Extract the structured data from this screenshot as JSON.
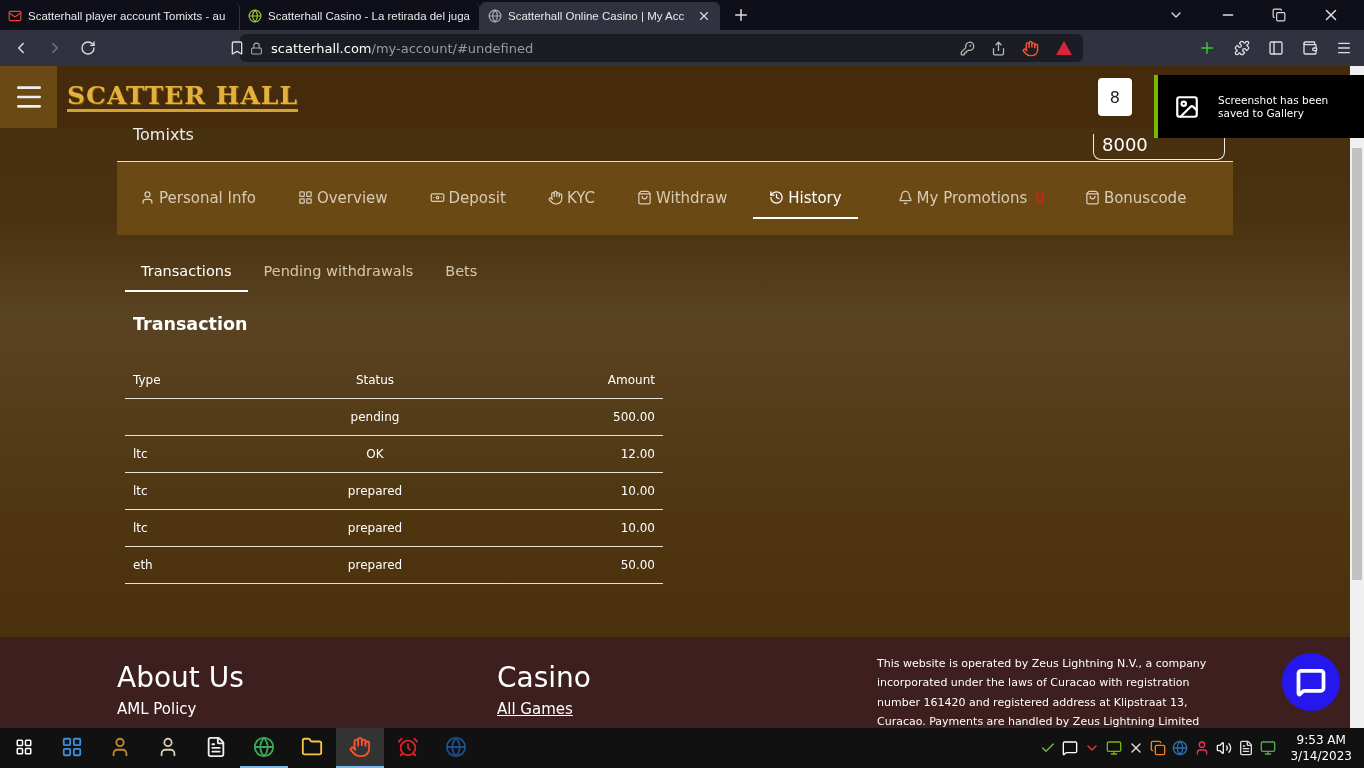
{
  "browser": {
    "tabs": [
      {
        "title": "Scatterhall player account Tomixts - au",
        "kind": "mail",
        "selected": false
      },
      {
        "title": "Scatterhall Casino - La retirada del juga",
        "kind": "letter",
        "selected": false
      },
      {
        "title": "Scatterhall Online Casino | My Acc",
        "kind": "globe",
        "selected": true
      }
    ],
    "url_host": "scatterhall.com",
    "url_path": "/my-account/#undefined"
  },
  "header": {
    "logo": "SCATTER HALL",
    "button_text": "8"
  },
  "notification": {
    "message": "Screenshot has been saved to Gallery"
  },
  "account": {
    "username": "Tomixts",
    "balance": "8000"
  },
  "nav": [
    {
      "label": "Personal Info",
      "kind": "user",
      "selected": false
    },
    {
      "label": "Overview",
      "kind": "grid",
      "selected": false
    },
    {
      "label": "Deposit",
      "kind": "deposit",
      "selected": false
    },
    {
      "label": "KYC",
      "kind": "hand",
      "selected": false
    },
    {
      "label": "Withdraw",
      "kind": "bag",
      "selected": false
    },
    {
      "label": "History",
      "kind": "history",
      "selected": true
    },
    {
      "label": "My Promotions",
      "kind": "bell",
      "selected": false,
      "badge": "0"
    },
    {
      "label": "Bonuscode",
      "kind": "bag",
      "selected": false
    }
  ],
  "subtabs": [
    {
      "label": "Transactions",
      "selected": true
    },
    {
      "label": "Pending withdrawals",
      "selected": false
    },
    {
      "label": "Bets",
      "selected": false
    }
  ],
  "table": {
    "title": "Transaction",
    "columns": [
      "Type",
      "Status",
      "Amount"
    ],
    "rows": [
      [
        "",
        "pending",
        "500.00"
      ],
      [
        "ltc",
        "OK",
        "12.00"
      ],
      [
        "ltc",
        "prepared",
        "10.00"
      ],
      [
        "ltc",
        "prepared",
        "10.00"
      ],
      [
        "eth",
        "prepared",
        "50.00"
      ]
    ]
  },
  "footer": {
    "columns": [
      {
        "heading": "About Us",
        "link": "AML Policy",
        "underlined": false
      },
      {
        "heading": "Casino",
        "link": "All Games",
        "underlined": true
      }
    ],
    "legal": "This website is operated by Zeus Lightning N.V., a company incorporated under the laws of Curacao with registration number 161420 and registered address at Klipstraat 13, Curacao. Payments are handled by Zeus Lightning Limited"
  },
  "taskbar": {
    "apps": [
      {
        "kind": "widgets",
        "running": false,
        "selected": false
      },
      {
        "kind": "game",
        "running": false,
        "selected": false
      },
      {
        "kind": "face",
        "running": false,
        "selected": false
      },
      {
        "kind": "file",
        "running": false,
        "selected": false
      },
      {
        "kind": "chrome",
        "running": true,
        "selected": false
      },
      {
        "kind": "folder",
        "running": false,
        "selected": false
      },
      {
        "kind": "brave",
        "running": true,
        "selected": true
      },
      {
        "kind": "alarm",
        "running": false,
        "selected": false
      },
      {
        "kind": "steam",
        "running": false,
        "selected": false
      }
    ],
    "tray": [
      {
        "kind": "check"
      },
      {
        "kind": "chat"
      },
      {
        "kind": "chevron"
      },
      {
        "kind": "gpu"
      },
      {
        "kind": "bird"
      },
      {
        "kind": "java"
      },
      {
        "kind": "steam"
      },
      {
        "kind": "mascot"
      },
      {
        "kind": "speaker"
      },
      {
        "kind": "epic"
      },
      {
        "kind": "monitor"
      }
    ],
    "time": "9:53 AM",
    "date": "3/14/2023"
  }
}
